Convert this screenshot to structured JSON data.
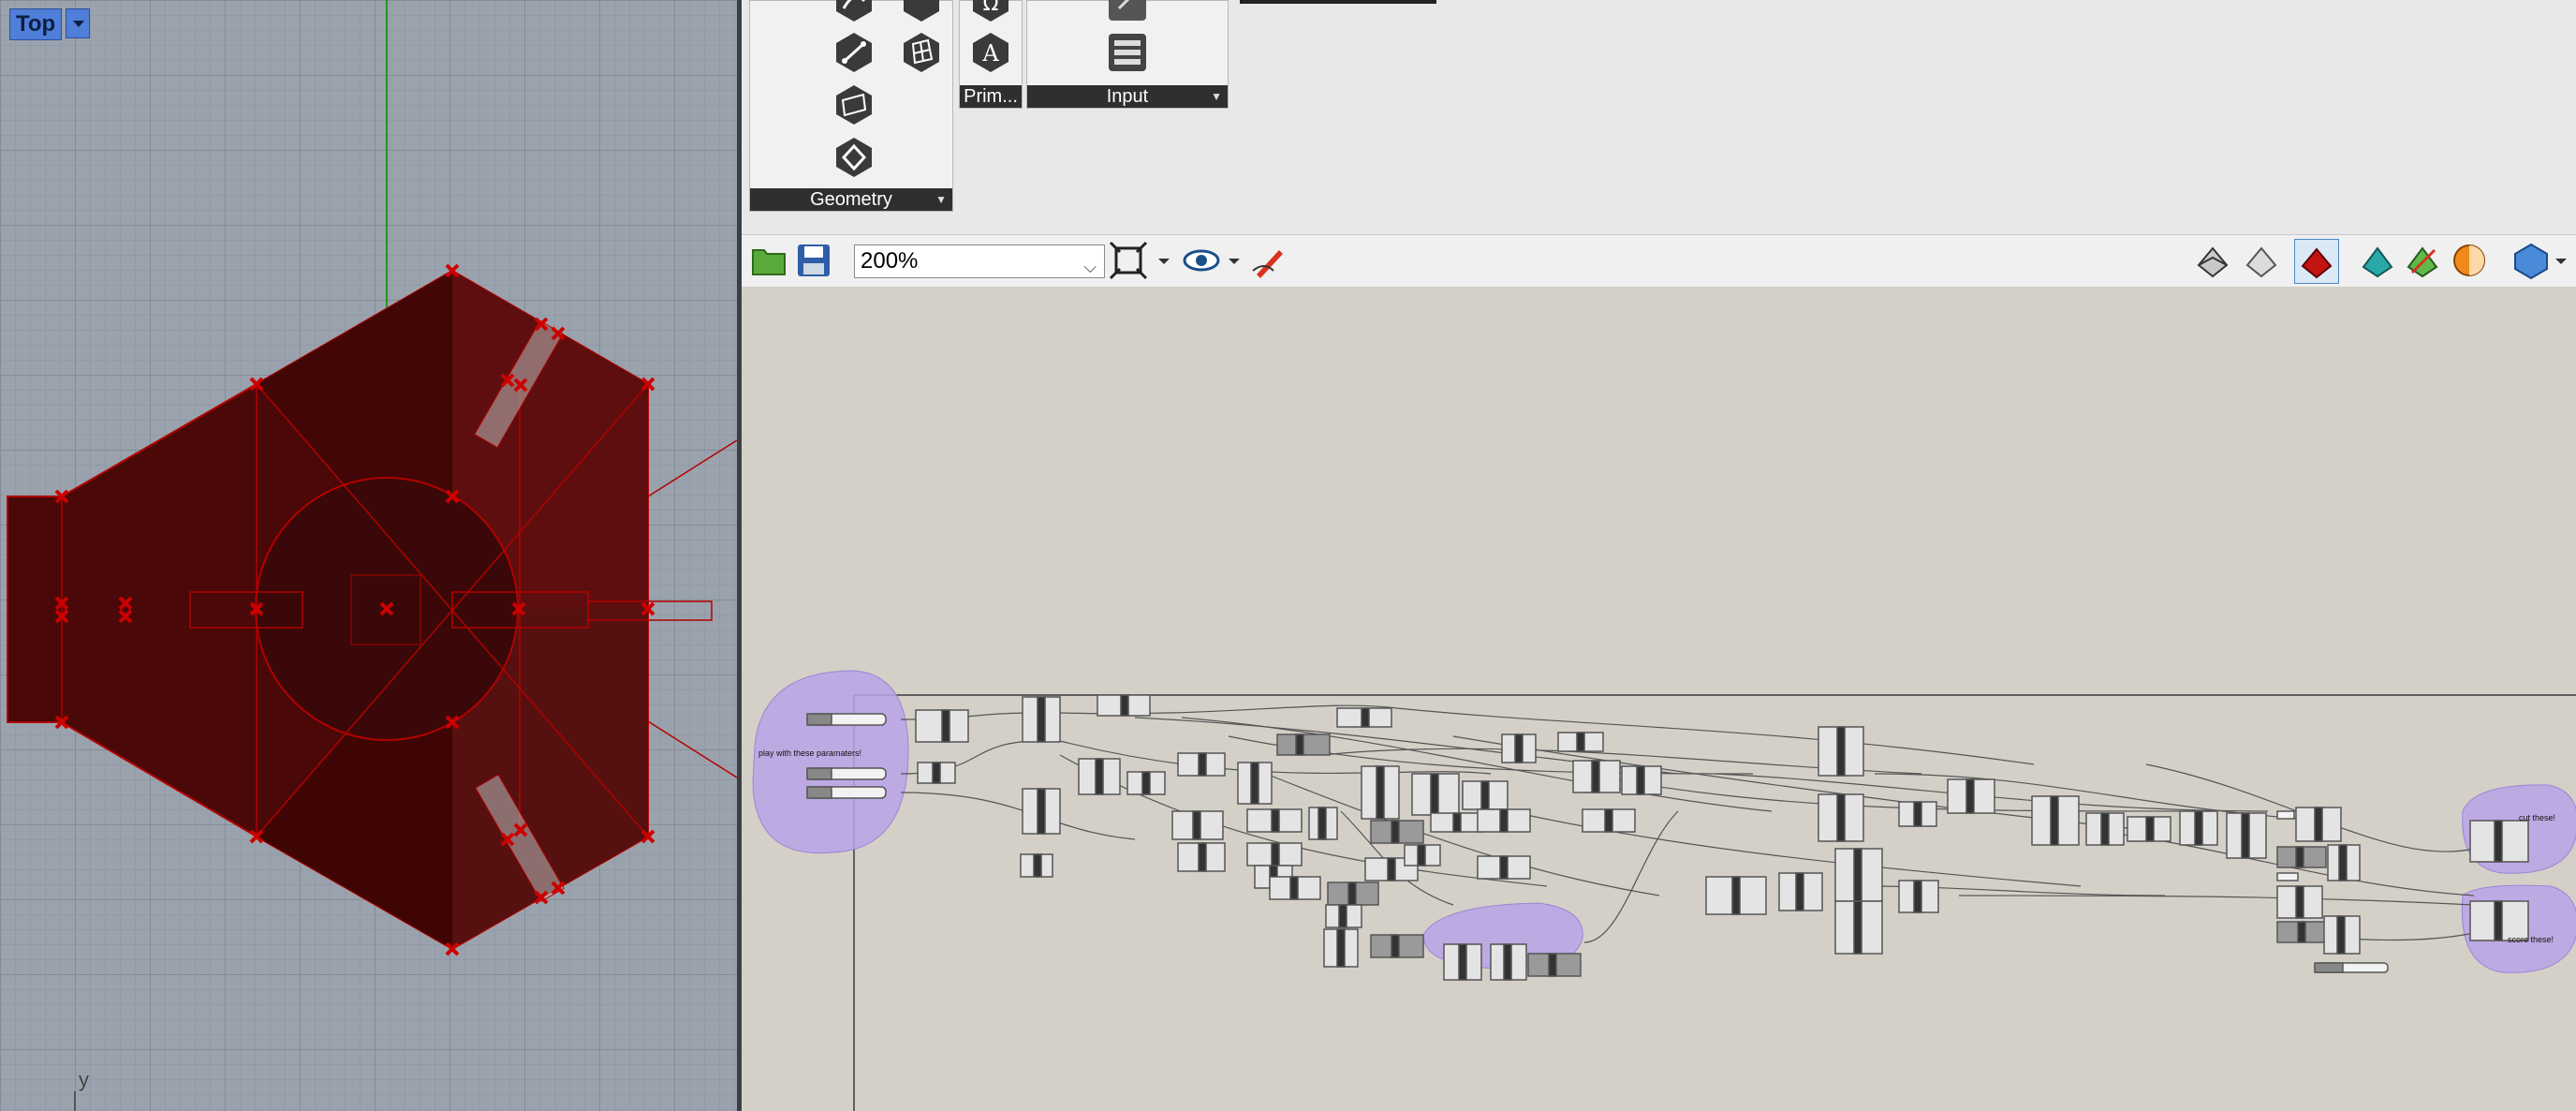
{
  "viewport": {
    "name": "Top",
    "axis_label": "y",
    "colors": {
      "background": "#9aa3ad",
      "geometry": "#5a0c0c",
      "points": "#cc0000"
    }
  },
  "ribbon": {
    "panels": [
      {
        "label": "Geometry",
        "icons": [
          "curve-icon",
          "line-icon",
          "surface-icon",
          "brep-icon",
          "mesh-icon",
          "field-icon"
        ]
      },
      {
        "label": "Prim...",
        "icons": [
          "omega-icon",
          "text-icon"
        ]
      },
      {
        "label": "Input",
        "icons": [
          "slider-icon",
          "list-icon"
        ]
      }
    ]
  },
  "toolbar": {
    "zoom": "200%",
    "icons": [
      "open-file-icon",
      "save-icon",
      "zoom-extents-icon",
      "preview-eye-icon",
      "sketch-pen-icon",
      "preview-wire-icon",
      "preview-shaded-icon",
      "preview-selected-icon",
      "bake-icon",
      "colour-icon",
      "mesh-quality-icon",
      "sphere-icon"
    ]
  },
  "canvas": {
    "groups": [
      {
        "label": "play with these paramaters!",
        "color": "#b8a3e8"
      },
      {
        "label": "cut these!",
        "color": "#b8a3e8"
      },
      {
        "label": "score these!",
        "color": "#b8a3e8"
      }
    ]
  }
}
